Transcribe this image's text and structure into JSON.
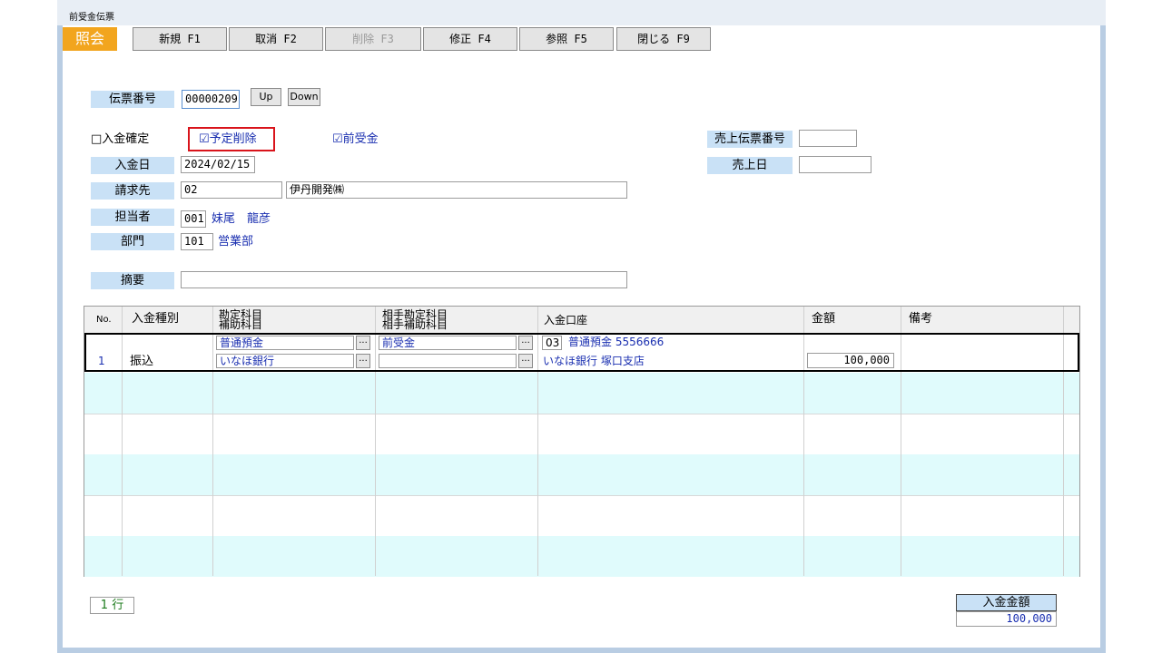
{
  "window": {
    "title": "前受金伝票"
  },
  "toolbar": {
    "mode": "照会",
    "buttons": [
      {
        "label": "新規 F1",
        "enabled": true
      },
      {
        "label": "取消 F2",
        "enabled": true
      },
      {
        "label": "削除 F3",
        "enabled": false
      },
      {
        "label": "修正 F4",
        "enabled": true
      },
      {
        "label": "参照 F5",
        "enabled": true
      },
      {
        "label": "閉じる F9",
        "enabled": true
      }
    ]
  },
  "header": {
    "slip_no_label": "伝票番号",
    "slip_no_value": "00000209",
    "up_label": "Up",
    "down_label": "Down",
    "deposit_confirmed": "□入金確定",
    "scheduled_delete": "☑予定削除",
    "advance_payment": "☑前受金",
    "sales_slip_label": "売上伝票番号",
    "sales_slip_value": "",
    "sales_date_label": "売上日",
    "sales_date_value": "",
    "deposit_date_label": "入金日",
    "deposit_date_value": "2024/02/15",
    "billing_label": "請求先",
    "billing_code": "02",
    "billing_name": "伊丹開発㈱",
    "staff_label": "担当者",
    "staff_code": "001",
    "staff_name": "妹尾　龍彦",
    "dept_label": "部門",
    "dept_code": "101",
    "dept_name": "営業部",
    "summary_label": "摘要",
    "summary_value": ""
  },
  "grid": {
    "headers": {
      "no": "No.",
      "type": "入金種別",
      "account1": "勘定科目",
      "account2": "補助科目",
      "counter1": "相手勘定科目",
      "counter2": "相手補助科目",
      "bank": "入金口座",
      "amount": "金額",
      "remarks": "備考"
    },
    "rows": [
      {
        "no": "1",
        "type": "振込",
        "account": "普通預金",
        "sub_account": "いなほ銀行",
        "counter_account": "前受金",
        "counter_sub": "",
        "bank_code": "03",
        "bank_line1": "普通預金 5556666",
        "bank_line2": "いなほ銀行 塚口支店",
        "amount": "100,000",
        "remarks": ""
      }
    ],
    "dots": "..."
  },
  "footer": {
    "row_count": "1 行",
    "total_label": "入金金額",
    "total_value": "100,000"
  }
}
